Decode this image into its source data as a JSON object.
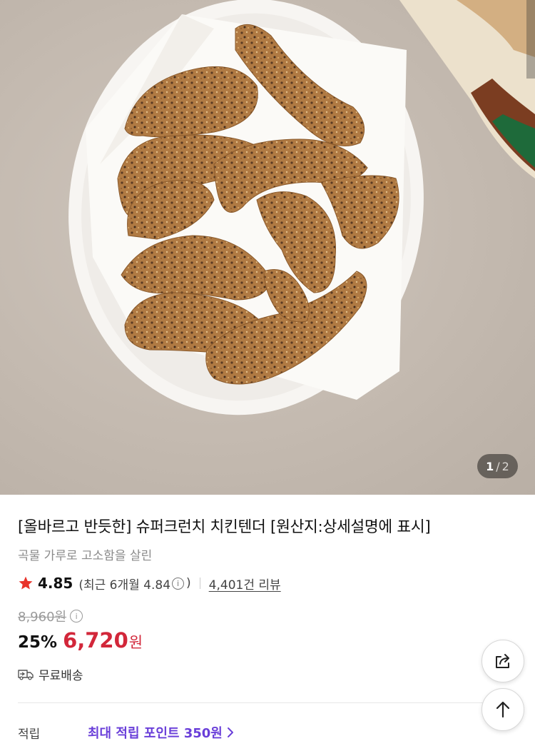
{
  "product_image": {
    "alt": "",
    "page_current": "1",
    "page_separator": "/",
    "page_total": "2"
  },
  "product": {
    "title": "[올바르고 반듯한] 슈퍼크런치 치킨텐더 [원산지:상세설명에 표시]",
    "subtitle": "곡물 가루로 고소함을 살린",
    "rating": "4.85",
    "recent_rating_prefix": "(최근 6개월 4.84",
    "recent_rating_suffix": ")",
    "info_glyph": "i",
    "review_count": "4,401건 리뷰",
    "original_price": "8,960원",
    "discount_rate": "25%",
    "sale_price": "6,720",
    "currency": "원",
    "delivery": "무료배송",
    "points_label": "적립",
    "points_value": "최대 적립 포인트 350원"
  },
  "colors": {
    "sale_red": "#d2273a",
    "points_purple": "#6a3fd9",
    "star_red": "#e8332a"
  },
  "icons": {
    "star": "star-icon",
    "info": "info-icon",
    "truck": "truck-icon",
    "chevron": "chevron-right-icon",
    "share": "share-icon",
    "scroll_top": "arrow-up-icon"
  }
}
